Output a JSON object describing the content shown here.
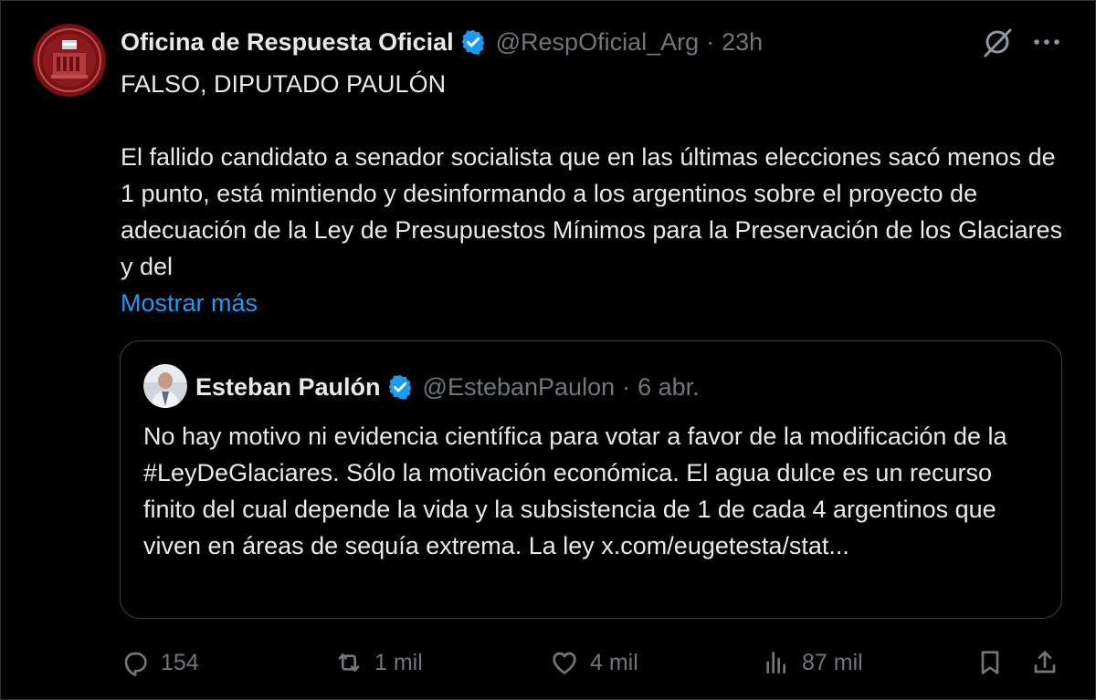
{
  "tweet": {
    "author_name": "Oficina de Respuesta Oficial",
    "author_handle": "@RespOficial_Arg",
    "separator": "·",
    "time": "23h",
    "text_line1": "FALSO, DIPUTADO PAULÓN",
    "text_body": "El fallido candidato a senador socialista que en las últimas elecciones sacó menos de 1 punto, está mintiendo y desinformando a los argentinos sobre el proyecto de adecuación de la Ley de Presupuestos Mínimos para la Preservación de los Glaciares y del",
    "show_more": "Mostrar más"
  },
  "quote": {
    "author_name": "Esteban Paulón",
    "author_handle": "@EstebanPaulon",
    "separator": "·",
    "date": "6 abr.",
    "text": "No hay motivo ni evidencia científica para votar a favor de la modificación de la #LeyDeGlaciares. Sólo la motivación económica. El agua dulce es un recurso finito del cual depende la vida y la subsistencia de 1 de cada 4 argentinos que viven en áreas de sequía extrema. La ley x.com/eugetesta/stat..."
  },
  "actions": {
    "replies": "154",
    "reposts": "1 mil",
    "likes": "4 mil",
    "views": "87 mil"
  },
  "icons": {
    "verified": "verified-badge-icon",
    "grok": "grok-icon",
    "more": "more-icon",
    "reply": "reply-icon",
    "repost": "repost-icon",
    "like": "like-icon",
    "views": "views-icon",
    "bookmark": "bookmark-icon",
    "share": "share-icon"
  },
  "colors": {
    "background": "#000000",
    "text": "#e7e9ea",
    "muted": "#71767b",
    "link": "#1d9bf0",
    "verified": "#1d9bf0",
    "border": "#2f3336"
  }
}
